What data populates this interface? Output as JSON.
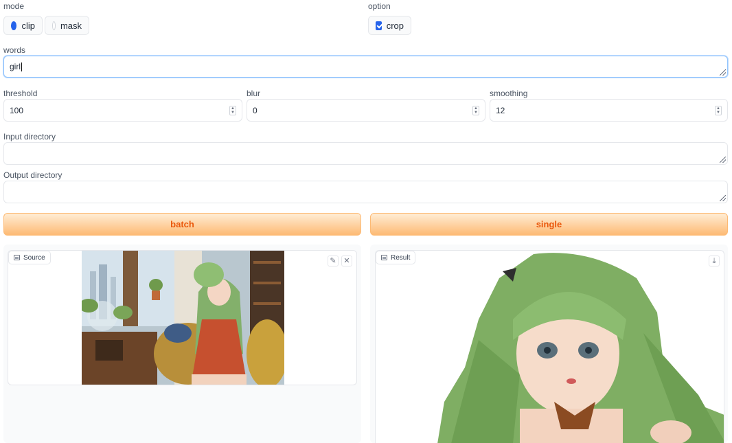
{
  "mode": {
    "label": "mode",
    "options": [
      {
        "label": "clip",
        "selected": true
      },
      {
        "label": "mask",
        "selected": false
      }
    ]
  },
  "option": {
    "label": "option",
    "checkbox": {
      "label": "crop",
      "checked": true
    }
  },
  "words": {
    "label": "words",
    "value": "girl"
  },
  "params": {
    "threshold": {
      "label": "threshold",
      "value": "100"
    },
    "blur": {
      "label": "blur",
      "value": "0"
    },
    "smoothing": {
      "label": "smoothing",
      "value": "12"
    }
  },
  "input_dir": {
    "label": "Input directory",
    "value": ""
  },
  "output_dir": {
    "label": "Output directory",
    "value": ""
  },
  "buttons": {
    "batch": "batch",
    "single": "single"
  },
  "source": {
    "label": "Source",
    "icon": "image-icon",
    "edit_icon": "pencil-icon",
    "close_icon": "close-icon"
  },
  "result": {
    "label": "Result",
    "icon": "image-icon",
    "download_icon": "download-icon"
  },
  "colors": {
    "accent": "#2563eb",
    "button_text": "#ea580c",
    "button_border": "#fdba74"
  }
}
